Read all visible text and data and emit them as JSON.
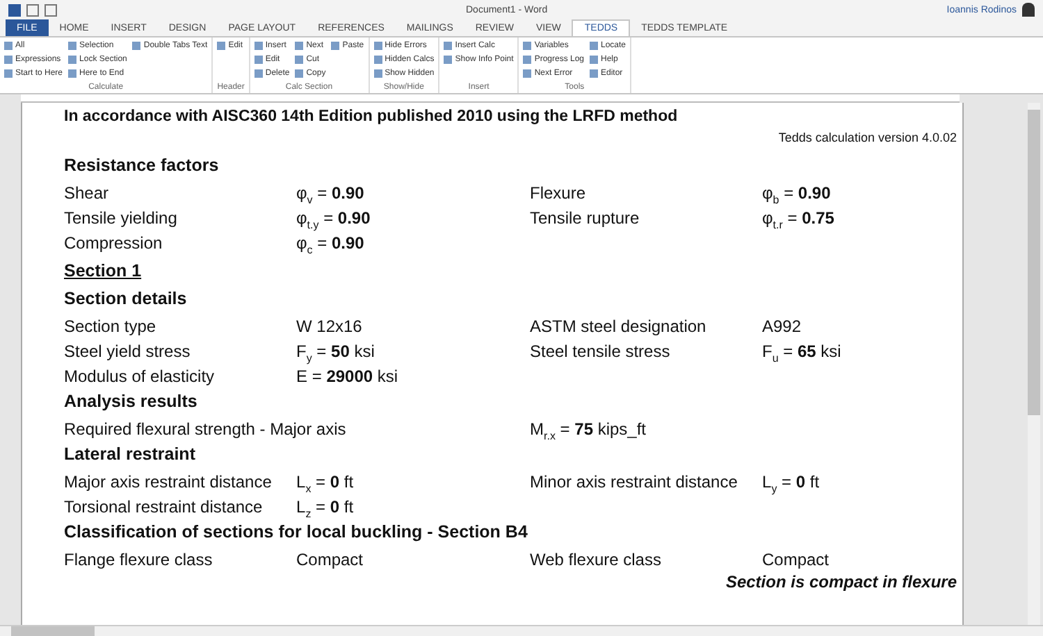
{
  "title_bar": {
    "title": "Document1 - Word",
    "user": "Ioannis Rodinos"
  },
  "tabs": [
    {
      "label": "FILE",
      "selected": false,
      "kind": "file"
    },
    {
      "label": "HOME",
      "selected": false
    },
    {
      "label": "INSERT",
      "selected": false
    },
    {
      "label": "DESIGN",
      "selected": false
    },
    {
      "label": "PAGE LAYOUT",
      "selected": false
    },
    {
      "label": "REFERENCES",
      "selected": false
    },
    {
      "label": "MAILINGS",
      "selected": false
    },
    {
      "label": "REVIEW",
      "selected": false
    },
    {
      "label": "VIEW",
      "selected": false
    },
    {
      "label": "TEDDS",
      "selected": true
    },
    {
      "label": "TEDDS TEMPLATE",
      "selected": false
    }
  ],
  "ribbon_groups": [
    {
      "label": "Calculate",
      "items": [
        "All",
        "Expressions",
        "Start to Here",
        "Selection",
        "Lock Section",
        "Here to End",
        "Double Tabs Text"
      ]
    },
    {
      "label": "Header",
      "items": [
        "Edit"
      ]
    },
    {
      "label": "Calc Section",
      "items": [
        "Insert",
        "Edit",
        "Delete",
        "Next",
        "Cut",
        "Copy",
        "Paste"
      ]
    },
    {
      "label": "Show/Hide",
      "items": [
        "Hide Errors",
        "Hidden Calcs",
        "Show Hidden"
      ]
    },
    {
      "label": "Insert",
      "items": [
        "Insert Calc",
        "Show Info Point"
      ]
    },
    {
      "label": "Tools",
      "items": [
        "Variables",
        "Progress Log",
        "Next Error",
        "Locate",
        "Help",
        "Editor"
      ]
    }
  ],
  "document": {
    "blocks": [
      {
        "kind": "title",
        "text": "In accordance with AISC360 14th Edition published 2010 using the LRFD method"
      },
      {
        "kind": "version",
        "text": "Tedds calculation version 4.0.02"
      },
      {
        "kind": "heading",
        "text": "Resistance factors"
      },
      {
        "kind": "row",
        "cells": [
          "Shear",
          "φ$_{v}$ = **0.90**",
          "Flexure",
          "φ$_{b}$ = **0.90**"
        ]
      },
      {
        "kind": "row",
        "cells": [
          "Tensile yielding",
          "φ$_{t.y}$ = **0.90**",
          "Tensile rupture",
          "φ$_{t.r}$ = **0.75**"
        ]
      },
      {
        "kind": "row",
        "cells": [
          "Compression",
          "φ$_{c}$ = **0.90**"
        ]
      },
      {
        "kind": "section",
        "text": "Section 1"
      },
      {
        "kind": "heading",
        "text": "Section details"
      },
      {
        "kind": "row",
        "cells": [
          "Section type",
          "W 12x16",
          "ASTM steel designation",
          "A992"
        ]
      },
      {
        "kind": "row",
        "cells": [
          "Steel yield stress",
          "F$_{y}$ = **50** ksi",
          "Steel tensile stress",
          "F$_{u}$ = **65** ksi"
        ]
      },
      {
        "kind": "row",
        "cells": [
          "Modulus of elasticity",
          "E = **29000** ksi"
        ]
      },
      {
        "kind": "heading",
        "text": "Analysis results"
      },
      {
        "kind": "row",
        "cells": [
          "Required flexural strength - Major axis",
          "",
          "M$_{r.x}$ = **75** kips_ft"
        ]
      },
      {
        "kind": "heading",
        "text": "Lateral restraint"
      },
      {
        "kind": "row",
        "cells": [
          "Major axis restraint distance",
          "L$_{x}$ = **0** ft",
          "Minor axis restraint distance",
          "L$_{y}$ = **0** ft"
        ]
      },
      {
        "kind": "row",
        "cells": [
          "Torsional restraint distance",
          "L$_{z}$ = **0** ft"
        ]
      },
      {
        "kind": "heading",
        "text": "Classification of sections for local buckling - Section B4"
      },
      {
        "kind": "row",
        "cells": [
          "Flange flexure class",
          "Compact",
          "Web flexure class",
          "Compact"
        ]
      },
      {
        "kind": "conclusion",
        "text": "Section is compact in flexure"
      }
    ]
  }
}
